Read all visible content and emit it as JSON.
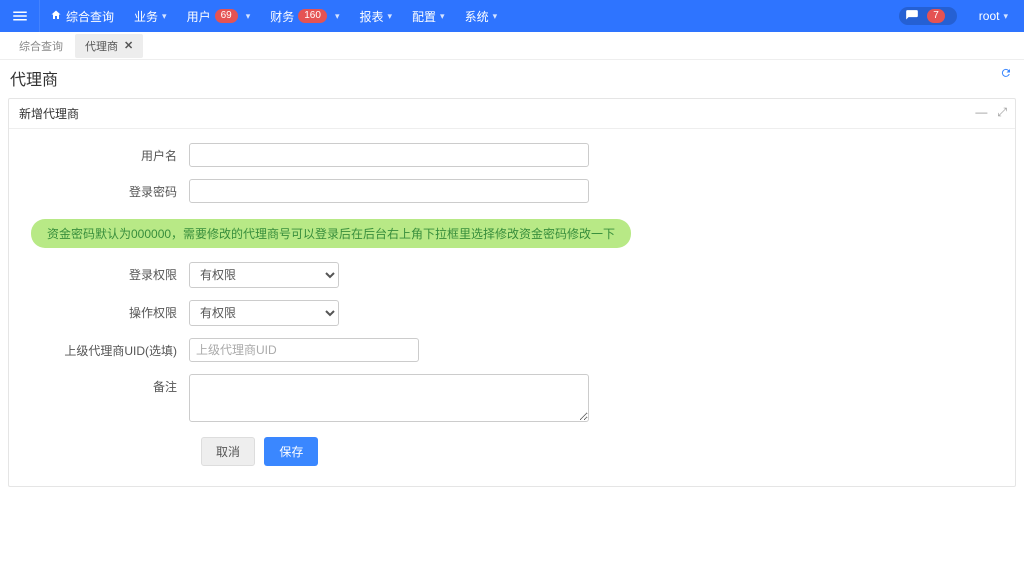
{
  "topbar": {
    "home_label": "综合查询",
    "menus": [
      {
        "label": "业务",
        "badge": null
      },
      {
        "label": "用户",
        "badge": "69"
      },
      {
        "label": "财务",
        "badge": "160"
      },
      {
        "label": "报表",
        "badge": null
      },
      {
        "label": "配置",
        "badge": null
      },
      {
        "label": "系统",
        "badge": null
      }
    ],
    "chat_badge": "7",
    "user_label": "root"
  },
  "tabs": {
    "items": [
      {
        "label": "综合查询",
        "active": false
      },
      {
        "label": "代理商",
        "active": true
      }
    ]
  },
  "page": {
    "title": "代理商"
  },
  "panel": {
    "title": "新增代理商",
    "minimize": "—",
    "expand": "⤢"
  },
  "form": {
    "username_label": "用户名",
    "password_label": "登录密码",
    "tip_text": "资金密码默认为000000，需要修改的代理商号可以登录后在后台右上角下拉框里选择修改资金密码修改一下",
    "login_perm_label": "登录权限",
    "login_perm_value": "有权限",
    "op_perm_label": "操作权限",
    "op_perm_value": "有权限",
    "parent_uid_label": "上级代理商UID(选填)",
    "parent_uid_placeholder": "上级代理商UID",
    "remark_label": "备注",
    "cancel_label": "取消",
    "save_label": "保存"
  }
}
